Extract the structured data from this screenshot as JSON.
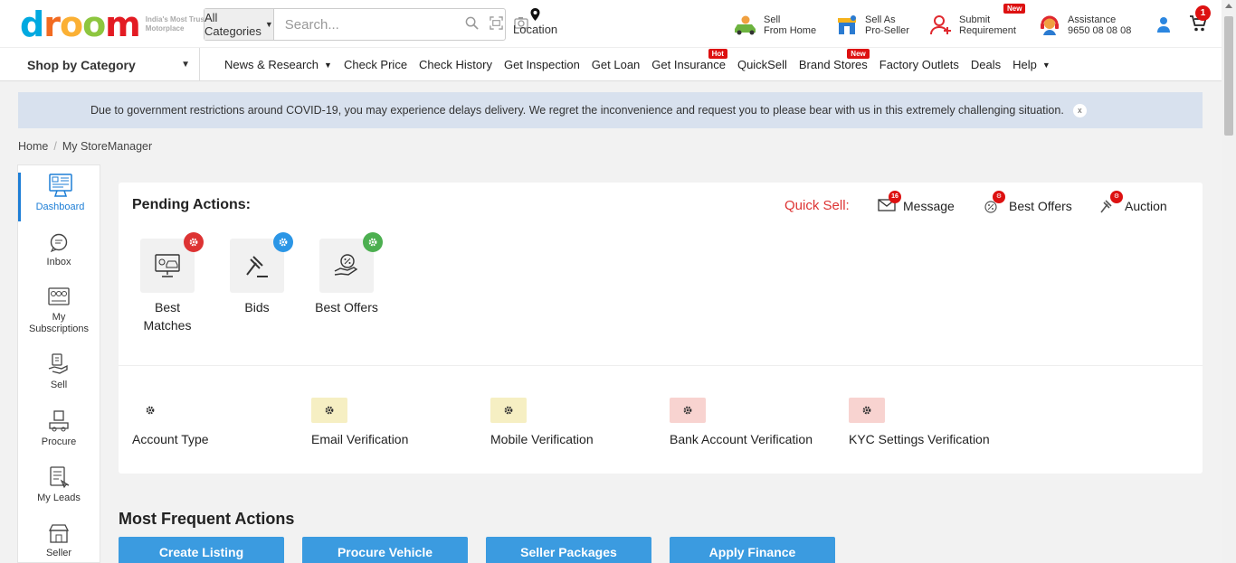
{
  "header": {
    "logo_tagline": "India's Most Trusted Motorplace",
    "category_select": "All Categories",
    "search_placeholder": "Search...",
    "location_label": "Location",
    "sell_home_l1": "Sell",
    "sell_home_l2": "From Home",
    "sell_pro_l1": "Sell As",
    "sell_pro_l2": "Pro-Seller",
    "submit_req_l1": "Submit",
    "submit_req_l2": "Requirement",
    "submit_req_tag": "New",
    "assist_l1": "Assistance",
    "assist_l2": "9650 08 08 08",
    "cart_count": "1"
  },
  "nav": {
    "shop_by_category": "Shop by Category",
    "links": [
      {
        "label": "News & Research",
        "dropdown": true
      },
      {
        "label": "Check Price"
      },
      {
        "label": "Check History"
      },
      {
        "label": "Get Inspection"
      },
      {
        "label": "Get Loan"
      },
      {
        "label": "Get Insurance",
        "tag": "Hot"
      },
      {
        "label": "QuickSell"
      },
      {
        "label": "Brand Stores",
        "tag": "New"
      },
      {
        "label": "Factory Outlets"
      },
      {
        "label": "Deals"
      },
      {
        "label": "Help",
        "dropdown": true
      }
    ]
  },
  "banner": {
    "text": "Due to government restrictions around COVID-19, you may experience delays delivery. We regret the inconvenience and request you to please bear with us in this extremely challenging situation.",
    "close": "x"
  },
  "breadcrumb": {
    "home": "Home",
    "current": "My StoreManager"
  },
  "sidebar": {
    "dashboard": "Dashboard",
    "inbox": "Inbox",
    "subscriptions_l1": "My",
    "subscriptions_l2": "Subscriptions",
    "sell": "Sell",
    "procure": "Procure",
    "leads": "My Leads",
    "seller_l1": "Seller"
  },
  "pending": {
    "title": "Pending Actions:",
    "quick_sell_label": "Quick Sell:",
    "message": "Message",
    "message_count": "16",
    "best_offers_qs": "Best Offers",
    "auction": "Auction",
    "best_matches_l1": "Best",
    "best_matches_l2": "Matches",
    "bids": "Bids",
    "best_offers": "Best Offers"
  },
  "verification": {
    "account_type": "Account Type",
    "email": "Email Verification",
    "mobile": "Mobile Verification",
    "bank": "Bank Account Verification",
    "kyc": "KYC Settings Verification"
  },
  "frequent": {
    "title": "Most Frequent Actions",
    "create_listing": "Create Listing",
    "procure_vehicle": "Procure Vehicle",
    "seller_packages": "Seller Packages",
    "apply_finance": "Apply Finance"
  },
  "colors": {
    "accent_blue": "#3b9be0",
    "red": "#d11111",
    "banner_bg": "#d8e1ee"
  }
}
